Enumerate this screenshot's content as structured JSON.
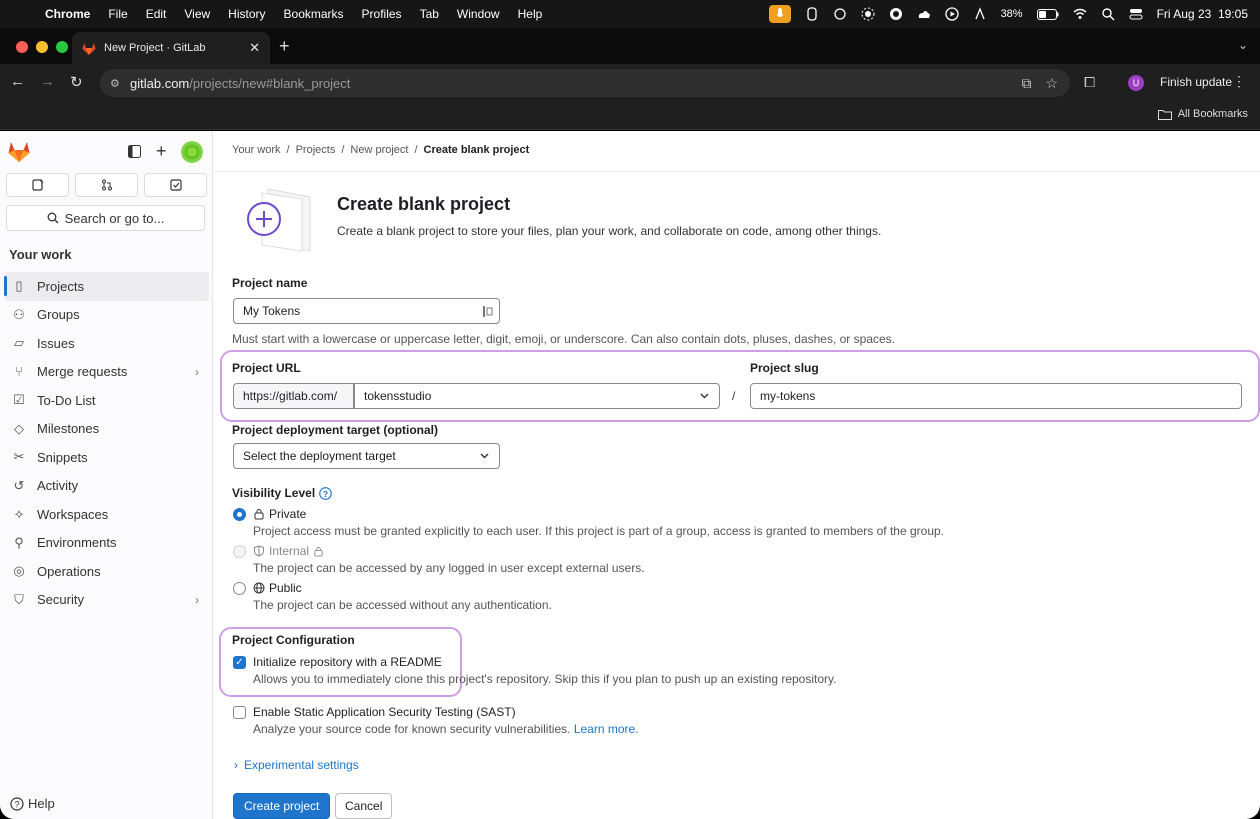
{
  "menubar": {
    "app": "Chrome",
    "items": [
      "File",
      "Edit",
      "View",
      "History",
      "Bookmarks",
      "Profiles",
      "Tab",
      "Window",
      "Help"
    ],
    "battery": "38%",
    "datetime": "Fri Aug 23  19:05"
  },
  "browser": {
    "tab_title": "New Project · GitLab",
    "url_host": "gitlab.com",
    "url_path": "/projects/new#blank_project",
    "profile_initial": "U",
    "finish_update": "Finish update",
    "all_bookmarks": "All Bookmarks"
  },
  "sidebar": {
    "search": "Search or go to...",
    "heading": "Your work",
    "items": [
      {
        "label": "Projects",
        "icon": "project-icon"
      },
      {
        "label": "Groups",
        "icon": "group-icon"
      },
      {
        "label": "Issues",
        "icon": "issues-icon"
      },
      {
        "label": "Merge requests",
        "icon": "merge-request-icon"
      },
      {
        "label": "To-Do List",
        "icon": "todo-icon"
      },
      {
        "label": "Milestones",
        "icon": "milestone-icon"
      },
      {
        "label": "Snippets",
        "icon": "snippet-icon"
      },
      {
        "label": "Activity",
        "icon": "history-icon"
      },
      {
        "label": "Workspaces",
        "icon": "workspace-icon"
      },
      {
        "label": "Environments",
        "icon": "environment-icon"
      },
      {
        "label": "Operations",
        "icon": "operations-icon"
      },
      {
        "label": "Security",
        "icon": "shield-icon"
      }
    ],
    "help": "Help"
  },
  "breadcrumb": [
    "Your work",
    "Projects",
    "New project",
    "Create blank project"
  ],
  "header": {
    "title": "Create blank project",
    "subtitle": "Create a blank project to store your files, plan your work, and collaborate on code, among other things."
  },
  "form": {
    "name_label": "Project name",
    "name_value": "My Tokens",
    "name_help": "Must start with a lowercase or uppercase letter, digit, emoji, or underscore. Can also contain dots, pluses, dashes, or spaces.",
    "url_label": "Project URL",
    "url_prefix": "https://gitlab.com/",
    "namespace": "tokensstudio",
    "slash": "/",
    "slug_label": "Project slug",
    "slug_value": "my-tokens",
    "deploy_label": "Project deployment target (optional)",
    "deploy_value": "Select the deployment target",
    "visibility_label": "Visibility Level",
    "visibility": [
      {
        "label": "Private",
        "desc": "Project access must be granted explicitly to each user. If this project is part of a group, access is granted to members of the group."
      },
      {
        "label": "Internal",
        "desc": "The project can be accessed by any logged in user except external users."
      },
      {
        "label": "Public",
        "desc": "The project can be accessed without any authentication."
      }
    ],
    "config_label": "Project Configuration",
    "readme_label": "Initialize repository with a README",
    "readme_desc": "Allows you to immediately clone this project's repository. Skip this if you plan to push up an existing repository.",
    "sast_label": "Enable Static Application Security Testing (SAST)",
    "sast_desc": "Analyze your source code for known security vulnerabilities.",
    "sast_link": "Learn more.",
    "experimental": "Experimental settings",
    "create_button": "Create project",
    "cancel_button": "Cancel"
  },
  "colors": {
    "accent": "#1f75cb",
    "highlight": "#cf9ee8",
    "gitlab_orange": "#e24329"
  }
}
